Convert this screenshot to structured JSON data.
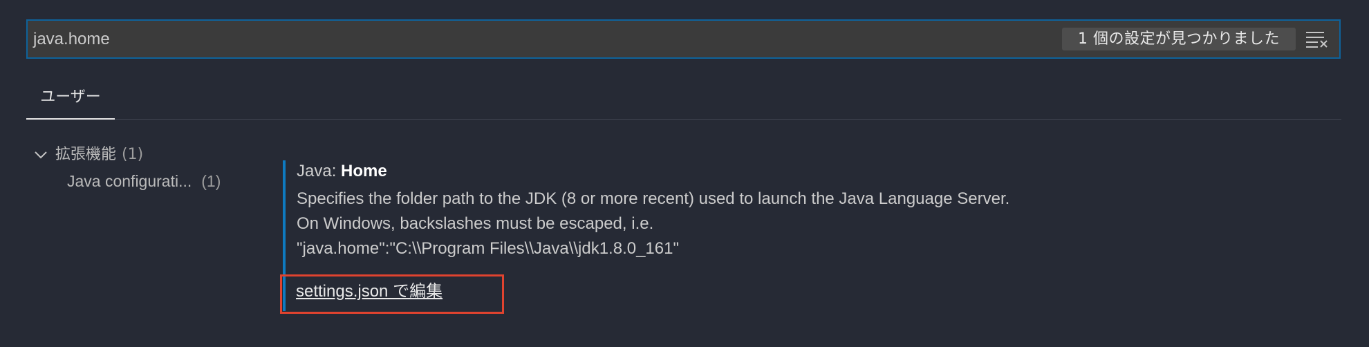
{
  "search": {
    "value": "java.home",
    "result_count": "1 個の設定が見つかりました",
    "clear_icon": "clear-filter-icon"
  },
  "tabs": [
    {
      "label": "ユーザー"
    }
  ],
  "toc": {
    "group_label": "拡張機能",
    "group_count": "(1)",
    "items": [
      {
        "label": "Java configurati...",
        "count": "(1)"
      }
    ]
  },
  "setting": {
    "category": "Java: ",
    "name": "Home",
    "description": [
      "Specifies the folder path to the JDK (8 or more recent) used to launch the Java Language Server.",
      "On Windows, backslashes must be escaped, i.e.",
      "\"java.home\":\"C:\\\\Program Files\\\\Java\\\\jdk1.8.0_161\""
    ],
    "edit_link": "settings.json で編集"
  },
  "colors": {
    "accent": "#0e639c",
    "highlight_box": "#e0432f"
  }
}
